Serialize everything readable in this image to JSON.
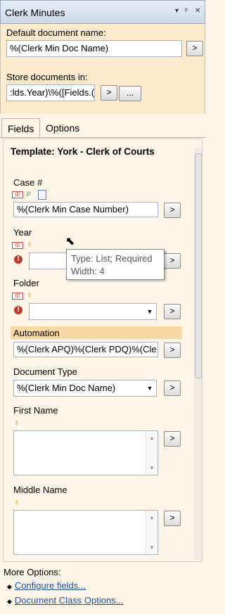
{
  "window": {
    "title": "Clerk Minutes",
    "controls": [
      "▾",
      "ᵖ",
      "✕"
    ]
  },
  "header": {
    "default_doc_label": "Default document name:",
    "default_doc_value": "%(Clerk Min Doc Name)",
    "store_label": "Store documents in:",
    "store_value": ":lds.Year)\\%([Fields.(",
    "button_arrow": ">",
    "button_browse": "..."
  },
  "tabs": [
    "Fields",
    "Options"
  ],
  "template": {
    "title": "Template: York - Clerk of Courts"
  },
  "fields": {
    "case": {
      "label": "Case #",
      "value": "%(Clerk Min Case Number)"
    },
    "year": {
      "label": "Year",
      "value": ""
    },
    "folder": {
      "label": "Folder",
      "value": ""
    },
    "automation": {
      "label": "Automation",
      "value": "%(Clerk APQ)%(Clerk PDQ)%(Cle"
    },
    "document_type": {
      "label": "Document Type",
      "value": "%(Clerk Min Doc Name)"
    },
    "first_name": {
      "label": "First Name",
      "value": ""
    },
    "middle_name": {
      "label": "Middle Name",
      "value": ""
    }
  },
  "tooltip": {
    "line1": "Type: List; Required",
    "line2": "Width: 4"
  },
  "footer": {
    "more_options": "More Options:",
    "links": [
      "Configure fields...",
      "Document Class Options..."
    ]
  },
  "icons": {
    "required": "!",
    "bullet": "◆",
    "combo_arrow": "▼",
    "scroll_up": "▲",
    "scroll_down": "▼"
  },
  "colors": {
    "accent_panel": "#fde9cc",
    "automation_highlight": "#f8d8a4",
    "link": "#1c4fa3",
    "required": "#c0392b"
  }
}
